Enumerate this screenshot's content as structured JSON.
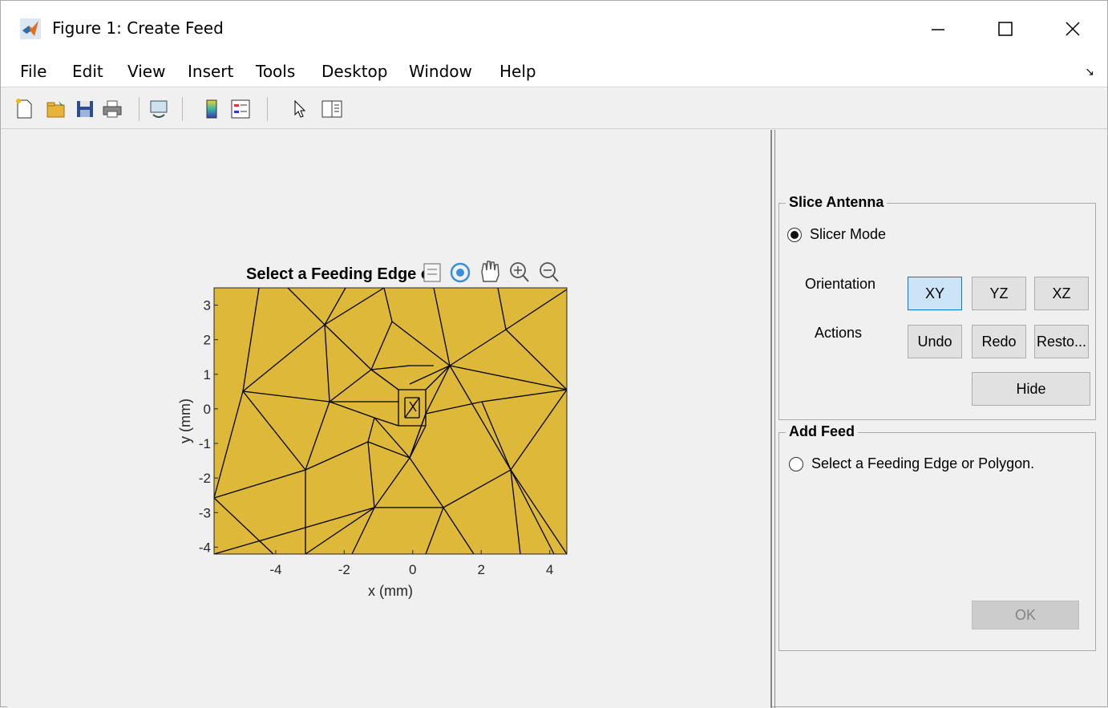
{
  "window": {
    "title": "Figure 1: Create Feed",
    "controls": [
      "minimize-icon",
      "maximize-icon",
      "close-icon"
    ]
  },
  "menubar": {
    "items": [
      "File",
      "Edit",
      "View",
      "Insert",
      "Tools",
      "Desktop",
      "Window",
      "Help"
    ]
  },
  "toolbar": {
    "icons": [
      "new-figure-icon",
      "open-file-icon",
      "save-icon",
      "print-icon",
      "link-plot-icon",
      "colorbar-icon",
      "legend-icon",
      "edit-plot-pointer-icon",
      "property-inspector-icon"
    ]
  },
  "axes": {
    "title": "Select a Feeding Edge or Polygon.",
    "xlabel": "x (mm)",
    "ylabel": "y (mm)",
    "xticks": [
      "-4",
      "-2",
      "0",
      "2",
      "4"
    ],
    "yticks": [
      "3",
      "2",
      "1",
      "0",
      "-1",
      "-2",
      "-3",
      "-4"
    ],
    "xlim": [
      -5.8,
      4.5
    ],
    "ylim": [
      -4.2,
      3.5
    ],
    "fill_color": "#deb838",
    "toolbar_icons": [
      "brush-data-icon",
      "rotate-3d-icon",
      "pan-icon",
      "zoom-in-icon",
      "zoom-out-icon"
    ]
  },
  "slice_antenna": {
    "title": "Slice Antenna",
    "slicer_mode_label": "Slicer Mode",
    "slicer_mode_selected": true,
    "orientation_label": "Orientation",
    "orientation_options": [
      "XY",
      "YZ",
      "XZ"
    ],
    "orientation_selected": "XY",
    "actions_label": "Actions",
    "undo_label": "Undo",
    "redo_label": "Redo",
    "restore_label": "Resto...",
    "hide_label": "Hide"
  },
  "add_feed": {
    "title": "Add Feed",
    "select_label": "Select a Feeding Edge or Polygon.",
    "select_checked": false,
    "ok_label": "OK",
    "ok_enabled": false
  },
  "colors": {
    "accent_selected": "#cce4f7",
    "accent_border": "#0078d7"
  }
}
